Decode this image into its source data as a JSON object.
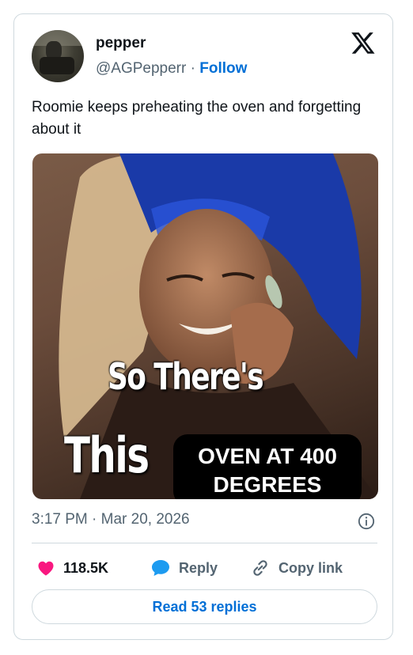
{
  "author": {
    "name": "pepper",
    "handle": "@AGPepperr",
    "separator": "·",
    "follow_label": "Follow"
  },
  "tweet": {
    "text": "Roomie keeps preheating the oven and forgetting about it",
    "meme_caption_line1": "So There's",
    "meme_caption_line2": "This",
    "meme_box_line1": "OVEN AT 400",
    "meme_box_line2": "DEGREES",
    "time": "3:17 PM",
    "date_separator": "·",
    "date": "Mar 20, 2026"
  },
  "actions": {
    "like_count": "118.5K",
    "reply_label": "Reply",
    "copy_label": "Copy link"
  },
  "read_replies_label": "Read 53 replies",
  "colors": {
    "accent": "#006fd6",
    "like": "#f91880",
    "reply": "#1d9bf0",
    "muted": "#536471",
    "border": "#cfd9de"
  },
  "icons": [
    "x-logo-icon",
    "info-icon",
    "heart-icon",
    "reply-bubble-icon",
    "link-icon"
  ]
}
